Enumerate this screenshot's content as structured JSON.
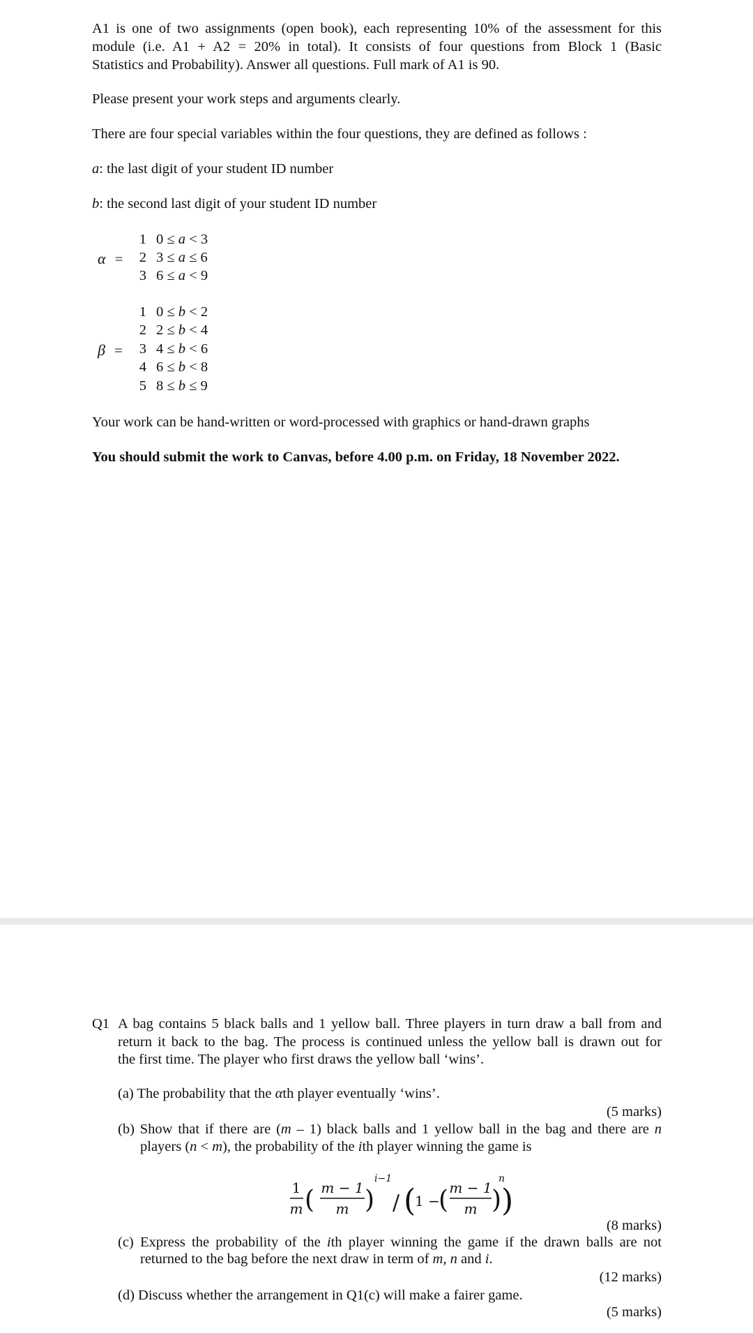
{
  "intro": {
    "lines": [
      "A1 is one of two assignments (open book), each representing 10% of the assessment for this",
      "module (i.e. A1 + A2 = 20% in total).  It consists of four questions from Block 1 (Basic",
      "Statistics and Probability).  Answer all questions.  Full mark of A1 is 90."
    ],
    "present_work": "Please present your work steps and arguments clearly.",
    "variables_intro": "There are four special variables within the four questions, they are defined as follows :"
  },
  "variables": {
    "a": {
      "symbol": "a",
      "definition": ": the last digit of your student ID number"
    },
    "b": {
      "symbol": "b",
      "definition": ": the second last digit of your student ID number"
    },
    "alpha": {
      "symbol": "α",
      "equals": "=",
      "cases": [
        {
          "value": "1",
          "lo": "0",
          "op1": "≤",
          "var": "a",
          "op2": "<",
          "hi": "3"
        },
        {
          "value": "2",
          "lo": "3",
          "op1": "≤",
          "var": "a",
          "op2": "≤",
          "hi": "6"
        },
        {
          "value": "3",
          "lo": "6",
          "op1": "≤",
          "var": "a",
          "op2": "<",
          "hi": "9"
        }
      ]
    },
    "beta": {
      "symbol": "β",
      "equals": "=",
      "cases": [
        {
          "value": "1",
          "lo": "0",
          "op1": "≤",
          "var": "b",
          "op2": "<",
          "hi": "2"
        },
        {
          "value": "2",
          "lo": "2",
          "op1": "≤",
          "var": "b",
          "op2": "<",
          "hi": "4"
        },
        {
          "value": "3",
          "lo": "4",
          "op1": "≤",
          "var": "b",
          "op2": "<",
          "hi": "6"
        },
        {
          "value": "4",
          "lo": "6",
          "op1": "≤",
          "var": "b",
          "op2": "<",
          "hi": "8"
        },
        {
          "value": "5",
          "lo": "8",
          "op1": "≤",
          "var": "b",
          "op2": "≤",
          "hi": "9"
        }
      ]
    }
  },
  "work_format": "Your work can be hand-written or word-processed with graphics or hand-drawn graphs",
  "deadline": "You should submit the work to Canvas, before 4.00 p.m. on Friday, 18 November 2022.",
  "q1": {
    "label": "Q1",
    "stem_lines": [
      "A bag contains 5 black balls and 1 yellow ball.  Three players in turn draw a ball from and",
      "return it back to the bag.  The process is continued unless the yellow ball is drawn out for",
      "the first time.  The player who first draws the yellow ball ‘wins’."
    ],
    "parts": {
      "a": {
        "prefix": "(a) The probability that the ",
        "var": "α",
        "suffix": "th player eventually ‘wins’.",
        "marks": "(5 marks)"
      },
      "b": {
        "line1_prefix": "(b) Show that if there are (",
        "line1_m": "m",
        "line1_mid": " – 1) black balls and 1 yellow ball in the bag and there are ",
        "line1_n": "n",
        "line2_prefix": "players (",
        "line2_n": "n",
        "line2_lt": " < ",
        "line2_m": "m",
        "line2_mid": "), the probability of the ",
        "line2_i": "i",
        "line2_suffix": "th player winning the game is",
        "formula": {
          "frac1_num": "1",
          "frac1_den": "m",
          "frac2_num": "m − 1",
          "frac2_den": "m",
          "exp1": "i−1",
          "slash": "/",
          "one_minus": "1 −",
          "frac3_num": "m − 1",
          "frac3_den": "m",
          "exp2": "n"
        },
        "marks": "(8 marks)"
      },
      "c": {
        "line1_prefix": "(c) Express the probability of the ",
        "line1_i": "i",
        "line1_suffix": "th player winning the game if the drawn balls are not",
        "line2_prefix": "returned to the bag before the next draw in term of ",
        "line2_m": "m",
        "line2_sep": ", ",
        "line2_n": "n",
        "line2_and": " and ",
        "line2_i": "i",
        "line2_end": ".",
        "marks": "(12 marks)"
      },
      "d": {
        "text": "(d) Discuss whether the arrangement in Q1(c) will make a fairer game.",
        "marks": "(5 marks)"
      }
    }
  }
}
